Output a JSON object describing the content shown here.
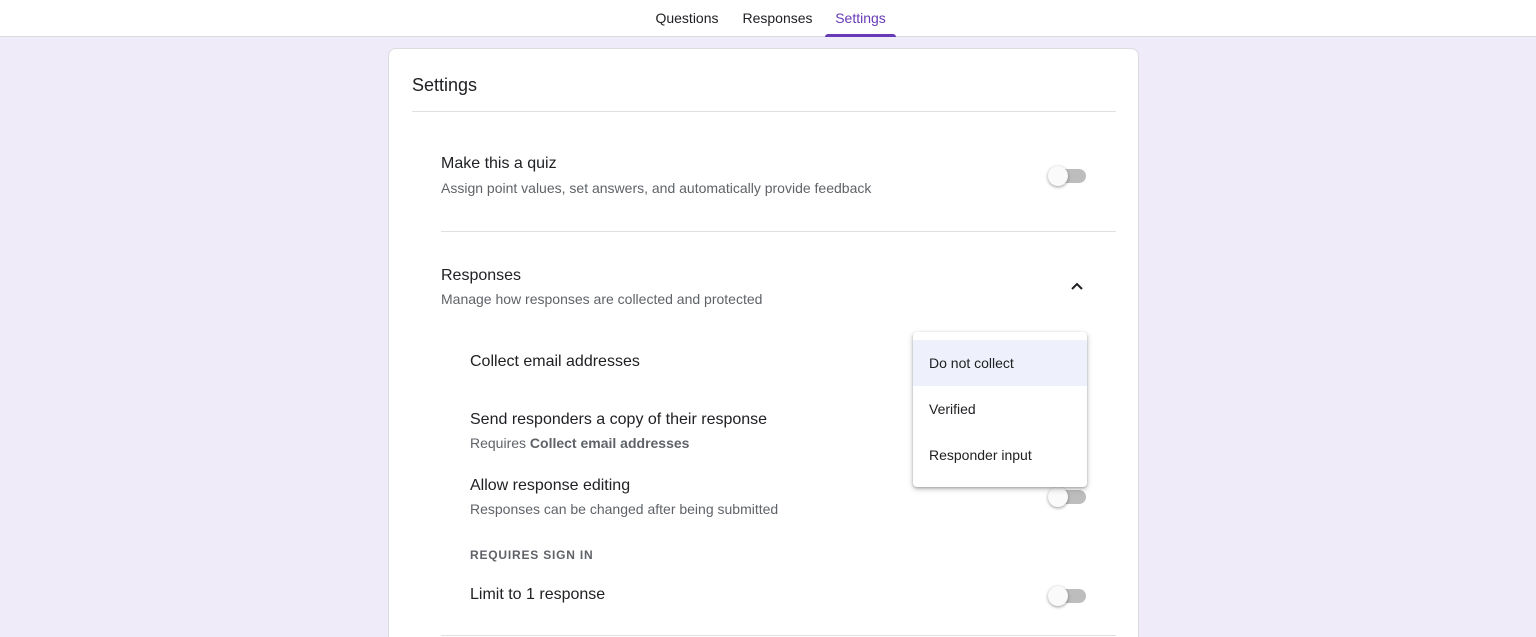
{
  "tabs": [
    {
      "label": "Questions",
      "active": false
    },
    {
      "label": "Responses",
      "active": false
    },
    {
      "label": "Settings",
      "active": true
    }
  ],
  "page_title": "Settings",
  "quiz": {
    "title": "Make this a quiz",
    "description": "Assign point values, set answers, and automatically provide feedback",
    "enabled": false
  },
  "responses_section": {
    "title": "Responses",
    "description": "Manage how responses are collected and protected",
    "expanded": true,
    "collect_email": {
      "title": "Collect email addresses"
    },
    "send_copy": {
      "title": "Send responders a copy of their response",
      "requires_prefix": "Requires",
      "requires_target": "Collect email addresses"
    },
    "allow_editing": {
      "title": "Allow response editing",
      "description": "Responses can be changed after being submitted",
      "enabled": false
    },
    "requires_sign_in_label": "REQUIRES SIGN IN",
    "limit_one": {
      "title": "Limit to 1 response",
      "enabled": false
    }
  },
  "email_dropdown": {
    "options": [
      "Do not collect",
      "Verified",
      "Responder input"
    ],
    "selected": "Do not collect"
  },
  "colors": {
    "accent": "#673ab7",
    "background": "#f0ebf8",
    "selected_option_bg": "#eef1fb"
  }
}
